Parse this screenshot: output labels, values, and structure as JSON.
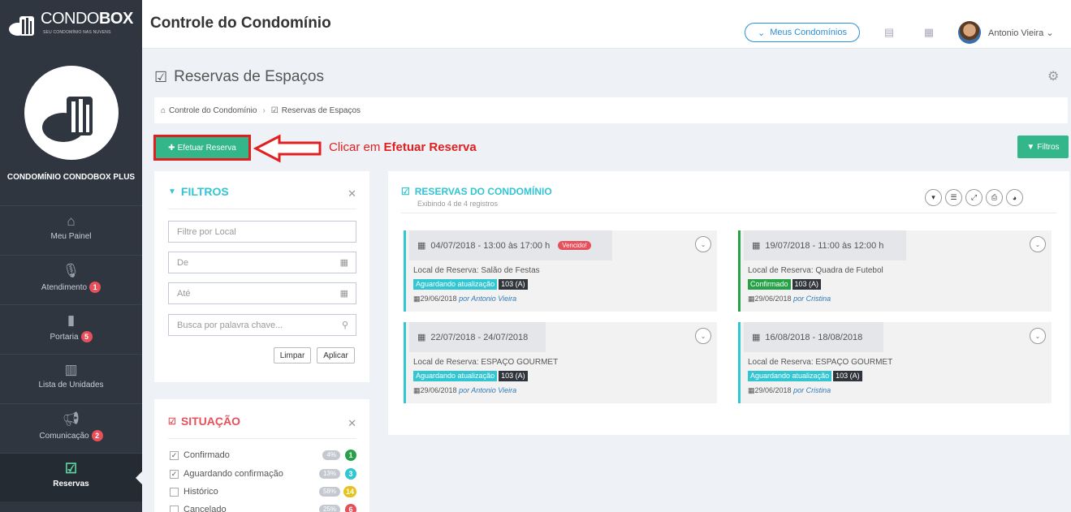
{
  "brand": {
    "name_light": "CONDO",
    "name_bold": "BOX",
    "tagline": "SEU CONDOMÍNIO NAS NUVENS"
  },
  "header": {
    "title": "Controle do Condomínio",
    "meus_condominios": "Meus Condomínios",
    "user_name": "Antonio Vieira"
  },
  "sidebar": {
    "condominio": "CONDOMÍNIO CONDOBOX PLUS",
    "items": [
      {
        "label": "Meu Painel",
        "icon": "home-icon",
        "badge": ""
      },
      {
        "label": "Atendimento",
        "icon": "microphone-icon",
        "badge": "1"
      },
      {
        "label": "Portaria",
        "icon": "door-icon",
        "badge": "5"
      },
      {
        "label": "Lista de Unidades",
        "icon": "building-icon",
        "badge": ""
      },
      {
        "label": "Comunicação",
        "icon": "megaphone-icon",
        "badge": "2"
      },
      {
        "label": "Reservas",
        "icon": "calendar-check-icon",
        "badge": ""
      }
    ]
  },
  "page": {
    "title": "Reservas de Espaços",
    "breadcrumb": [
      "Controle do Condomínio",
      "Reservas de Espaços"
    ],
    "efetuar_label": "Efetuar Reserva",
    "annotation_prefix": "Clicar em ",
    "annotation_bold": "Efetuar Reserva",
    "filtros_label": "Filtros"
  },
  "filtros": {
    "title": "FILTROS",
    "local_placeholder": "Filtre por Local",
    "de_placeholder": "De",
    "ate_placeholder": "Até",
    "busca_placeholder": "Busca por palavra chave...",
    "limpar": "Limpar",
    "aplicar": "Aplicar"
  },
  "situacao": {
    "title": "SITUAÇÃO",
    "items": [
      {
        "label": "Confirmado",
        "checked": true,
        "pct": "4%",
        "count": "1",
        "color": "#26a146"
      },
      {
        "label": "Aguardando confirmação",
        "checked": true,
        "pct": "13%",
        "count": "3",
        "color": "#32c5d2"
      },
      {
        "label": "Histórico",
        "checked": false,
        "pct": "58%",
        "count": "14",
        "color": "#e6c21b"
      },
      {
        "label": "Cancelado",
        "checked": false,
        "pct": "25%",
        "count": "6",
        "color": "#e7505a"
      }
    ]
  },
  "reservas": {
    "title": "RESERVAS DO CONDOMÍNIO",
    "subtitle": "Exibindo 4 de 4 registros",
    "cards": [
      {
        "period": "04/07/2018 - 13:00 às 17:00 h",
        "vencido": "Vencido!",
        "local": "Local de Reserva: Salão de Festas",
        "status": "Aguardando atualização",
        "unit": "103 (A)",
        "date": "29/06/2018",
        "by": "por Antonio Vieira"
      },
      {
        "period": "19/07/2018 - 11:00 às 12:00 h",
        "vencido": "",
        "local": "Local de Reserva: Quadra de Futebol",
        "status": "Confirmado",
        "unit": "103 (A)",
        "date": "29/06/2018",
        "by": "por Cristina"
      },
      {
        "period": "22/07/2018 - 24/07/2018",
        "vencido": "",
        "local": "Local de Reserva: ESPAÇO GOURMET",
        "status": "Aguardando atualização",
        "unit": "103 (A)",
        "date": "29/06/2018",
        "by": "por Antonio Vieira"
      },
      {
        "period": "16/08/2018 - 18/08/2018",
        "vencido": "",
        "local": "Local de Reserva: ESPAÇO GOURMET",
        "status": "Aguardando atualização",
        "unit": "103 (A)",
        "date": "29/06/2018",
        "by": "por Cristina"
      }
    ]
  },
  "colors": {
    "sidebar": "#2f3640",
    "accent_green": "#32b68a",
    "cyan": "#32c5d2",
    "confirm_green": "#26a146",
    "red": "#e7505a",
    "annotation": "#e02020"
  }
}
